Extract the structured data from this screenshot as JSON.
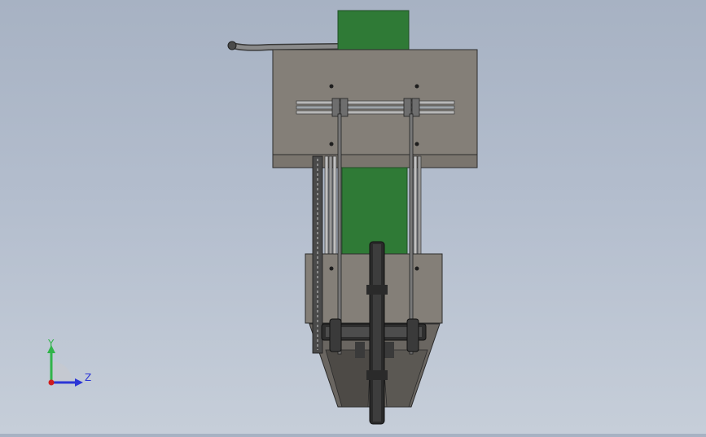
{
  "viewport": {
    "background_top": "#a7b2c3",
    "background_bottom": "#c6ced9"
  },
  "model": {
    "colors": {
      "belt": "#2f7a36",
      "belt_dark": "#245f2a",
      "plate": "#847f78",
      "plate_edge": "#2c2c2c",
      "rail": "#b8b8b8",
      "dark_steel": "#2e2e2e",
      "hopper": "#5e5b57",
      "chain": "#3a3a3a",
      "tube": "#6c6c6c"
    }
  },
  "triad": {
    "y_label": "Y",
    "z_label": "Z",
    "y_color": "#31b44a",
    "z_color": "#2b35d6",
    "origin_color": "#d01c1c"
  }
}
